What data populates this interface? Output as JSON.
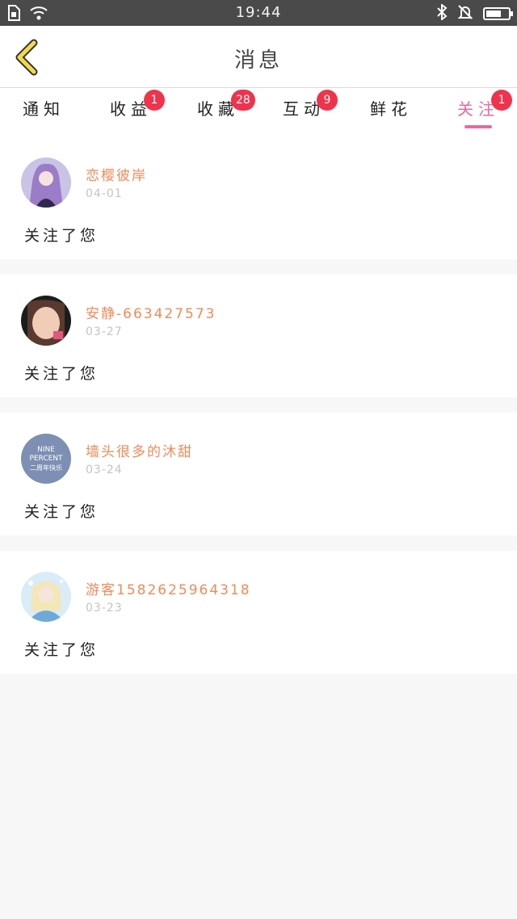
{
  "status_bar": {
    "time": "19:44"
  },
  "header": {
    "title": "消息"
  },
  "tabs": [
    {
      "label": "通知",
      "badge": null,
      "active": false
    },
    {
      "label": "收益",
      "badge": "1",
      "active": false
    },
    {
      "label": "收藏",
      "badge": "28",
      "active": false
    },
    {
      "label": "互动",
      "badge": "9",
      "active": false
    },
    {
      "label": "鲜花",
      "badge": null,
      "active": false
    },
    {
      "label": "关注",
      "badge": "1",
      "active": true
    }
  ],
  "messages": [
    {
      "name": "恋樱彼岸",
      "date": "04-01",
      "text": "关注了您"
    },
    {
      "name": "安静-663427573",
      "date": "03-27",
      "text": "关注了您"
    },
    {
      "name": "墙头很多的沐甜",
      "date": "03-24",
      "text": "关注了您"
    },
    {
      "name": "游客1582625964318",
      "date": "03-23",
      "text": "关注了您"
    }
  ],
  "colors": {
    "accent": "#e86a9c",
    "badge": "#f0334d",
    "name": "#f08a5a"
  },
  "avatar_texts": {
    "nine_percent_line1": "NINE",
    "nine_percent_line2": "PERCENT",
    "nine_percent_line3": "二周年快乐"
  }
}
